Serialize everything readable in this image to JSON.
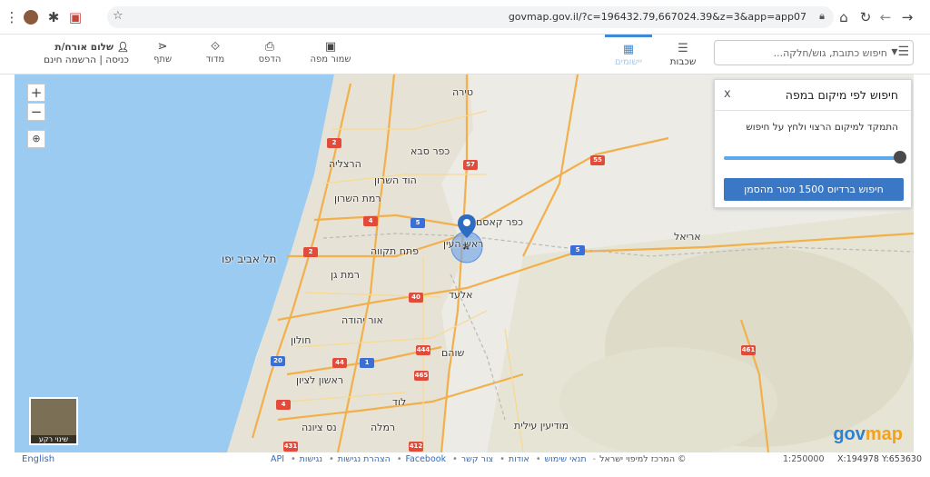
{
  "browser": {
    "url": "govmap.gov.il/?c=196432.79,667024.39&z=3&app=app07"
  },
  "toolbar": {
    "user_name": "שלום אורח/ת",
    "login_links": "כניסה | הרשמה חינם",
    "share": "שתף",
    "measure": "מדוד",
    "print": "הדפס",
    "save_map": "שמור מפה",
    "tab_layers": "יישומים",
    "tab_nets": "שכבות",
    "search_placeholder": "חיפוש כתובת, גוש/חלקה..."
  },
  "panel": {
    "title": "חיפוש לפי מיקום במפה",
    "close": "x",
    "instructions": "התמקד למיקום הרצוי ולחץ על חיפוש",
    "search_button": "חיפוש ברדיוס 1500 מטר מהסמן",
    "radius_fraction": 1.0
  },
  "map": {
    "zoom_in": "+",
    "zoom_out": "−",
    "basemap_caption": "שינוי רקע",
    "logo_a": "gov",
    "logo_b": "map",
    "places": {
      "tira": "טירה",
      "kfar_saba": "כפר סבא",
      "herzliya": "הרצליה",
      "hod_hasharon": "הוד השרון",
      "ramat_hasharon": "רמת השרון",
      "kfar_qasem": "כפר קאסם",
      "rosh_haayin": "ראש העין",
      "petah_tikva": "פתח תקווה",
      "tel_aviv": "תל אביב יפו",
      "ramat_gan": "רמת גן",
      "elad": "אלעד",
      "ariel": "אריאל",
      "or_yehuda": "אור יהודה",
      "holon": "חולון",
      "shoham": "שוהם",
      "rishon": "ראשון לציון",
      "lod": "לוד",
      "nes_ziona": "נס ציונה",
      "ramla": "רמלה",
      "modiin_illit": "מודיעין עילית"
    },
    "roads": {
      "r2a": "2",
      "r2b": "2",
      "r4a": "4",
      "r4b": "4",
      "r5a": "5",
      "r5b": "5",
      "r20": "20",
      "r40": "40",
      "r44": "44",
      "r1": "1",
      "r461": "461",
      "r55": "55",
      "r57": "57",
      "r444": "444",
      "r465": "465",
      "r431": "431",
      "r412": "412"
    }
  },
  "footer": {
    "english": "English",
    "copyright": "© המרכז למיפוי ישראל",
    "links": [
      "תנאי שימוש",
      "אודות",
      "צור קשר",
      "Facebook",
      "הצהרת נגישות",
      "נגישות",
      "API"
    ],
    "scale": "1:250000",
    "coords": "X:194978 Y:653630"
  }
}
